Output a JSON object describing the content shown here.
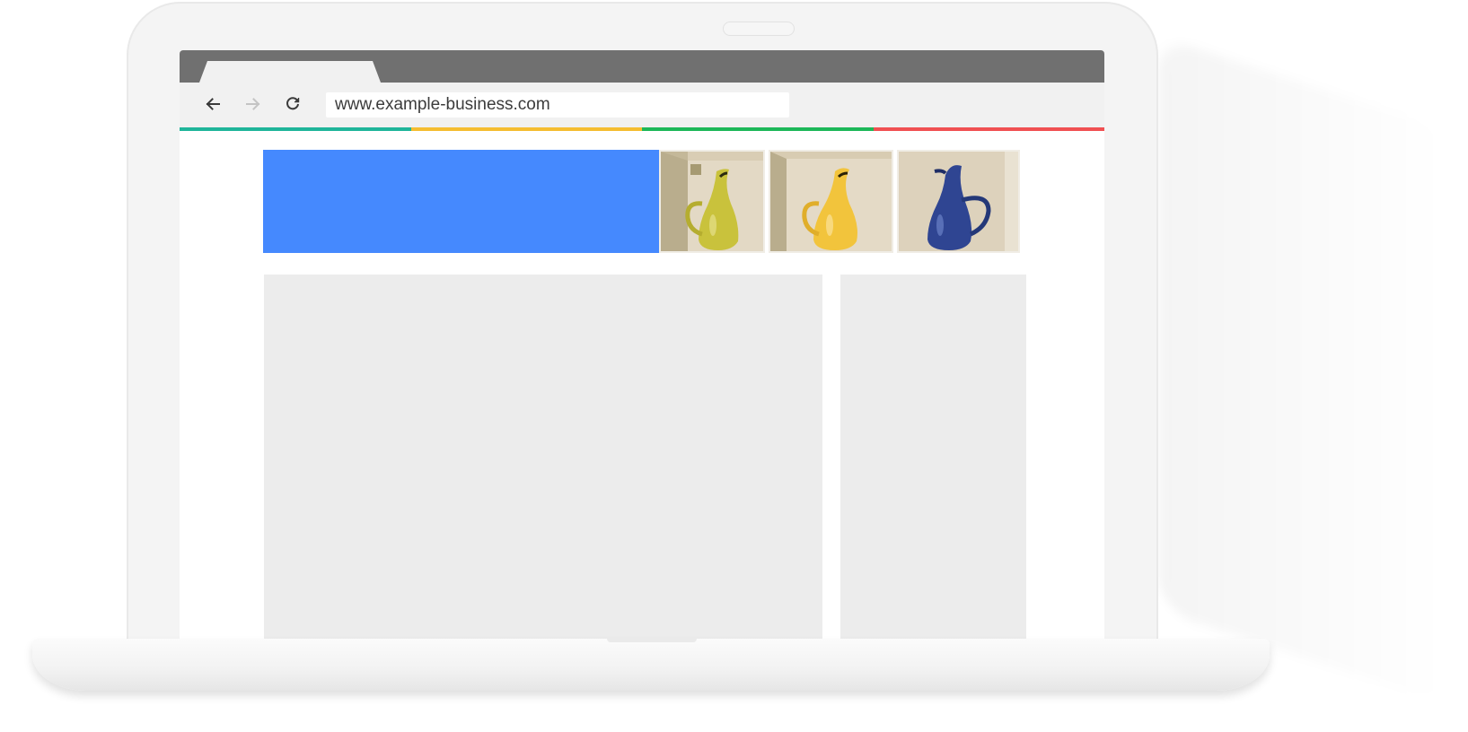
{
  "browser": {
    "url": "www.example-business.com",
    "tab_accent_colors": [
      "#1fb59a",
      "#f5bd31",
      "#1db859",
      "#f05052"
    ],
    "icons": {
      "back": "arrow-left-icon",
      "forward": "arrow-right-icon",
      "reload": "reload-icon"
    }
  },
  "page": {
    "banner": {
      "block_color": "#4589fe",
      "images": [
        {
          "subject": "yellow-green pitcher",
          "color": "#c9c23c"
        },
        {
          "subject": "yellow pitcher",
          "color": "#f2c43c"
        },
        {
          "subject": "blue pitcher",
          "color": "#2f4592"
        }
      ]
    },
    "placeholder_color": "#ececec"
  }
}
